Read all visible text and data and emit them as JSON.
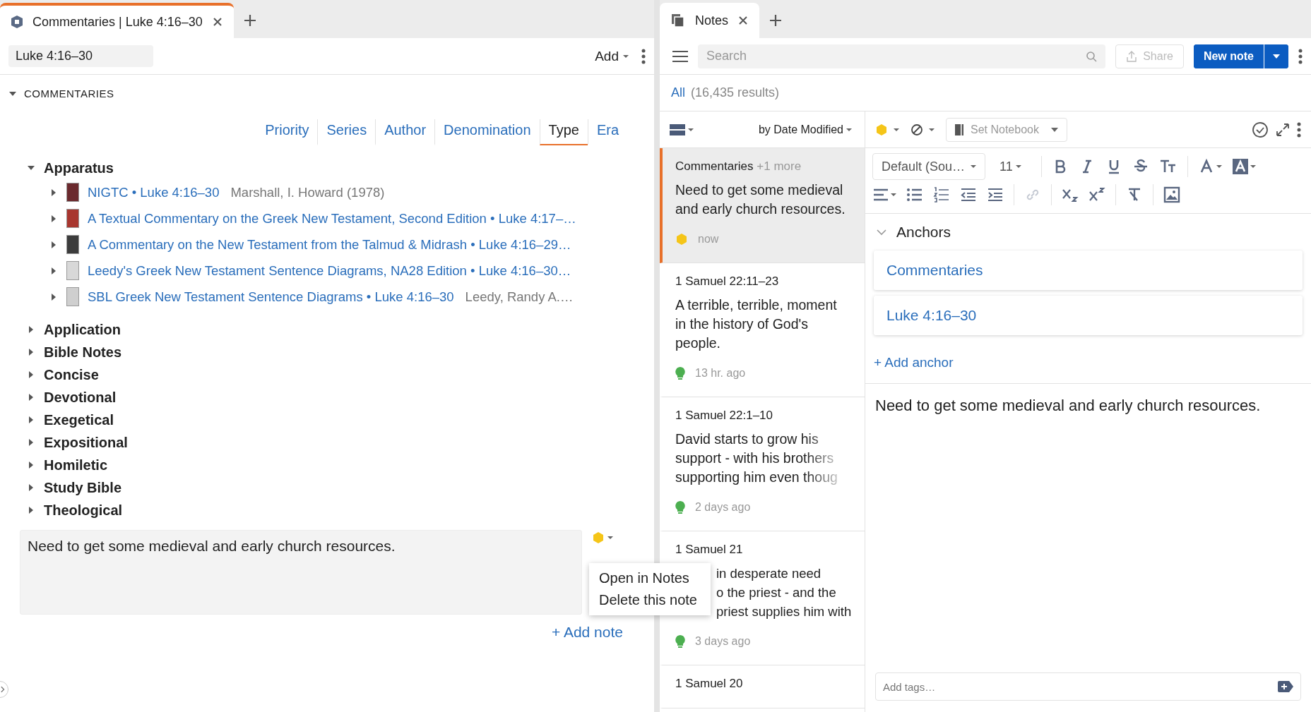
{
  "left_tab": {
    "title": "Commentaries | Luke 4:16–30"
  },
  "left_toolbar": {
    "reference": "Luke 4:16–30",
    "add_button": "Add"
  },
  "section": {
    "title": "COMMENTARIES",
    "expanded": true
  },
  "filter_tabs": [
    {
      "label": "Priority",
      "selected": false
    },
    {
      "label": "Series",
      "selected": false
    },
    {
      "label": "Author",
      "selected": false
    },
    {
      "label": "Denomination",
      "selected": false
    },
    {
      "label": "Type",
      "selected": true
    },
    {
      "label": "Era",
      "selected": false
    }
  ],
  "groups": [
    {
      "label": "Apparatus",
      "expanded": true,
      "children": [
        {
          "title": "NIGTC • Luke 4:16–30",
          "author": "Marshall, I. Howard (1978)",
          "color": "#6b2a2e",
          "expanded": false
        },
        {
          "title": "A Textual Commentary on the Greek New Testament, Second Edition • Luke 4:17–…",
          "color": "#a8362f",
          "expanded": false
        },
        {
          "title": "A Commentary on the New Testament from the Talmud & Midrash • Luke 4:16–29…",
          "color": "#3c3c3c",
          "expanded": false
        },
        {
          "title": "Leedy's Greek New Testament Sentence Diagrams, NA28 Edition • Luke 4:16–30…",
          "color": "#d8d8d8",
          "expanded": false
        },
        {
          "title": "SBL Greek New Testament Sentence Diagrams • Luke 4:16–30",
          "author": "Leedy, Randy A.…",
          "color": "#cfcfcf",
          "expanded": false
        }
      ]
    },
    {
      "label": "Application",
      "expanded": false
    },
    {
      "label": "Bible Notes",
      "expanded": false
    },
    {
      "label": "Concise",
      "expanded": false
    },
    {
      "label": "Devotional",
      "expanded": false
    },
    {
      "label": "Exegetical",
      "expanded": false
    },
    {
      "label": "Expositional",
      "expanded": false
    },
    {
      "label": "Homiletic",
      "expanded": false
    },
    {
      "label": "Study Bible",
      "expanded": false
    },
    {
      "label": "Theological",
      "expanded": false
    }
  ],
  "note_panel": {
    "text": "Need to get some medieval and early church resources.",
    "color": "#f5c518",
    "add_note": "+ Add note"
  },
  "context_menu": [
    "Open in Notes",
    "Delete this note"
  ],
  "right_tab": {
    "title": "Notes"
  },
  "notes_toolbar": {
    "search_placeholder": "Search",
    "share": "Share",
    "new_note": "New note"
  },
  "filter": {
    "all": "All",
    "count": "(16,435 results)"
  },
  "list_header": {
    "sort": "by Date Modified"
  },
  "notes": [
    {
      "anchor": "Commentaries",
      "more": "+1 more",
      "preview": "Need to get some medieval and early church resources.",
      "time": "now",
      "kind": "highlight",
      "color": "#f5c518",
      "selected": true
    },
    {
      "anchor": "1 Samuel 22:11–23",
      "preview": "A terrible, terrible, moment in the history of God's people.",
      "time": "13 hr. ago",
      "kind": "bulb",
      "color": "#4caf50",
      "selected": false
    },
    {
      "anchor": "1 Samuel 22:1–10",
      "preview": "David starts to grow his support - with his brothers supporting him even thoug",
      "time": "2 days ago",
      "kind": "bulb",
      "color": "#4caf50",
      "selected": false
    },
    {
      "anchor": "1 Samuel 21",
      "preview": "in desperate need\no the priest - and the\npriest supplies him with",
      "time": "3 days ago",
      "kind": "bulb",
      "color": "#4caf50",
      "selected": false
    },
    {
      "anchor": "1 Samuel 20",
      "selected": false
    }
  ],
  "editor": {
    "color": "#f5c518",
    "notebook": "Set Notebook",
    "font": "Default (Sou…",
    "size": "11",
    "anchors_title": "Anchors",
    "anchors_expanded": true,
    "anchors": [
      "Commentaries",
      "Luke 4:16–30"
    ],
    "add_anchor": "+ Add anchor",
    "body": "Need to get some medieval and early church resources.",
    "tags_placeholder": "Add tags…"
  }
}
